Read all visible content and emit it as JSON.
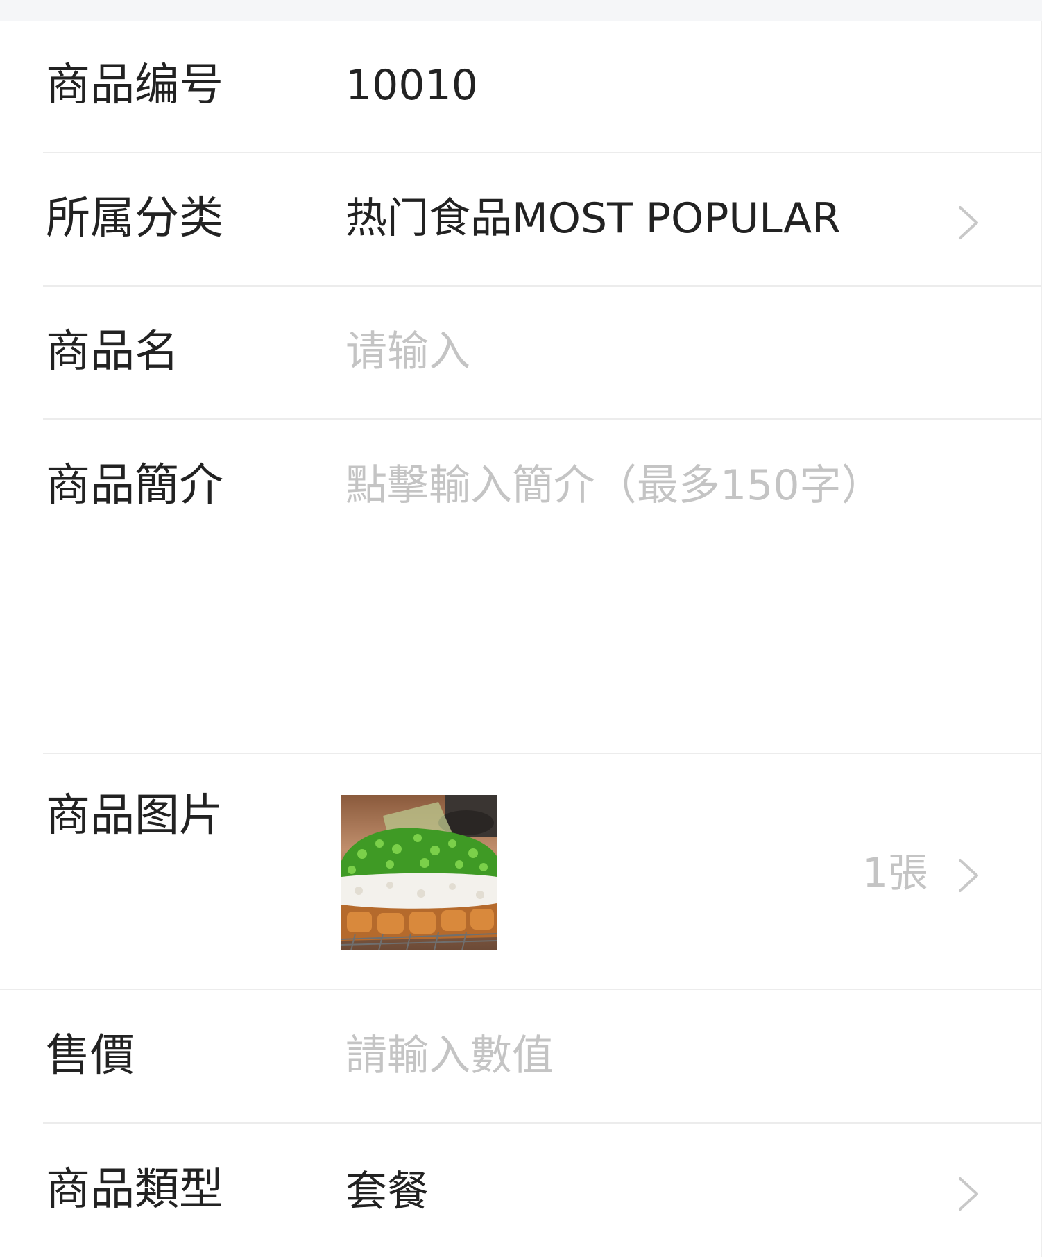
{
  "form": {
    "product_code": {
      "label": "商品编号",
      "value": "10010"
    },
    "category": {
      "label": "所属分类",
      "value": "热门食品MOST POPULAR",
      "icon": "chevron-right-icon"
    },
    "product_name": {
      "label": "商品名",
      "placeholder": "请输入"
    },
    "description": {
      "label": "商品簡介",
      "placeholder": "點擊輸入簡介（最多150字）"
    },
    "images": {
      "label": "商品图片",
      "count": "1張",
      "icon": "chevron-right-icon",
      "thumbnail": "fried-cutlet-with-grated-radish-and-scallions"
    },
    "price": {
      "label": "售價",
      "placeholder": "請輸入數值"
    },
    "product_type": {
      "label": "商品類型",
      "value": "套餐",
      "icon": "chevron-right-icon"
    }
  },
  "colors": {
    "text": "#222222",
    "placeholder": "#c4c4c4",
    "divider": "#ececec",
    "top_strip": "#f5f6f8",
    "chevron": "#c8c8c8"
  }
}
